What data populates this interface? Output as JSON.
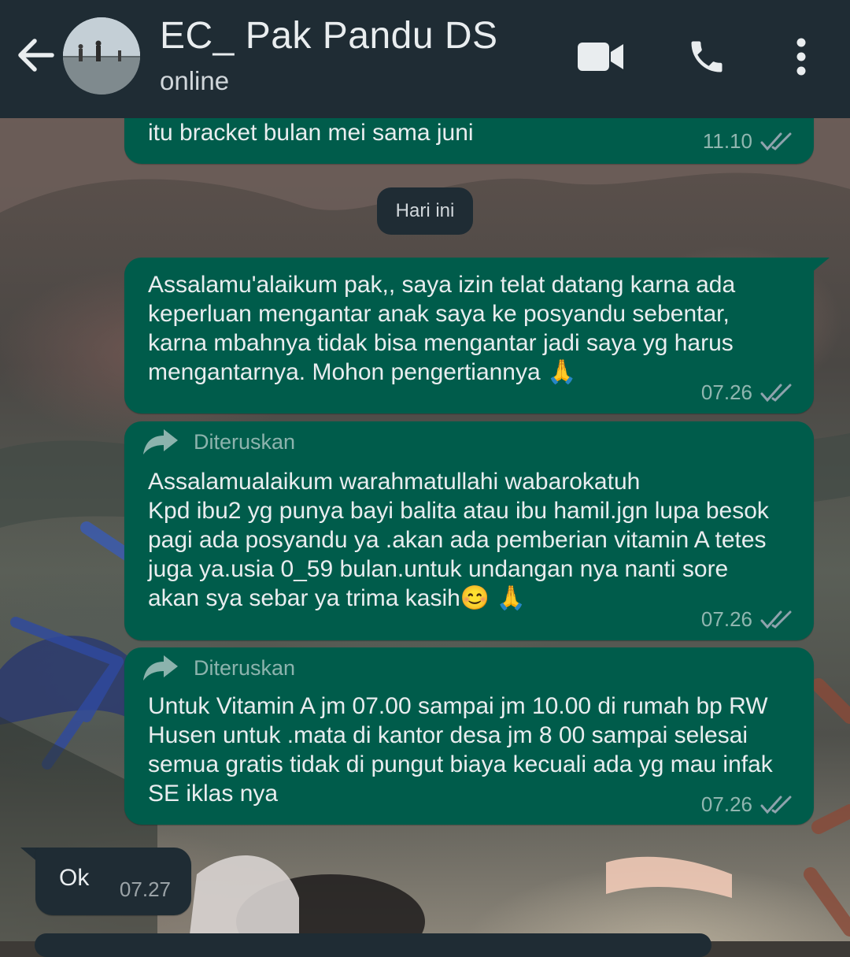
{
  "header": {
    "contact_name": "EC_ Pak Pandu DS",
    "status": "online",
    "icons": [
      "back-arrow-icon",
      "contact-avatar",
      "video-call-icon",
      "voice-call-icon",
      "more-options-icon"
    ]
  },
  "colors": {
    "header_bg": "#1f2c34",
    "outgoing_bubble": "#005c4b",
    "incoming_bubble": "#1f2c34",
    "text": "#e9edef",
    "read_ticks": "#8fa3ad"
  },
  "chat": {
    "date_separator": "Hari ini",
    "messages": [
      {
        "direction": "outgoing",
        "text": "itu bracket bulan mei sama juni",
        "time": "11.10",
        "status": "read"
      },
      {
        "direction": "outgoing",
        "text": "Assalamu'alaikum pak,, saya izin telat datang karna ada\nkeperluan mengantar anak saya ke posyandu sebentar,\nkarna mbahnya tidak bisa mengantar jadi saya yg harus\nmengantarnya. Mohon pengertiannya 🙏",
        "time": "07.26",
        "status": "read"
      },
      {
        "direction": "outgoing",
        "forwarded_label": "Diteruskan",
        "text": "Assalamualaikum warahmatullahi wabarokatuh\nKpd ibu2 yg punya bayi balita atau ibu hamil.jgn lupa besok\npagi ada posyandu ya .akan ada pemberian vitamin A tetes\njuga ya.usia 0_59 bulan.untuk undangan nya nanti sore\nakan sya sebar ya trima kasih😊 🙏",
        "time": "07.26",
        "status": "read"
      },
      {
        "direction": "outgoing",
        "forwarded_label": "Diteruskan",
        "text": "Untuk Vitamin A jm 07.00 sampai jm 10.00 di rumah bp RW\nHusen untuk .mata di kantor desa jm 8 00 sampai selesai\nsemua gratis tidak di pungut biaya kecuali ada yg mau infak\nSE iklas nya",
        "time": "07.26",
        "status": "read"
      },
      {
        "direction": "incoming",
        "text": "Ok",
        "time": "07.27"
      }
    ]
  }
}
